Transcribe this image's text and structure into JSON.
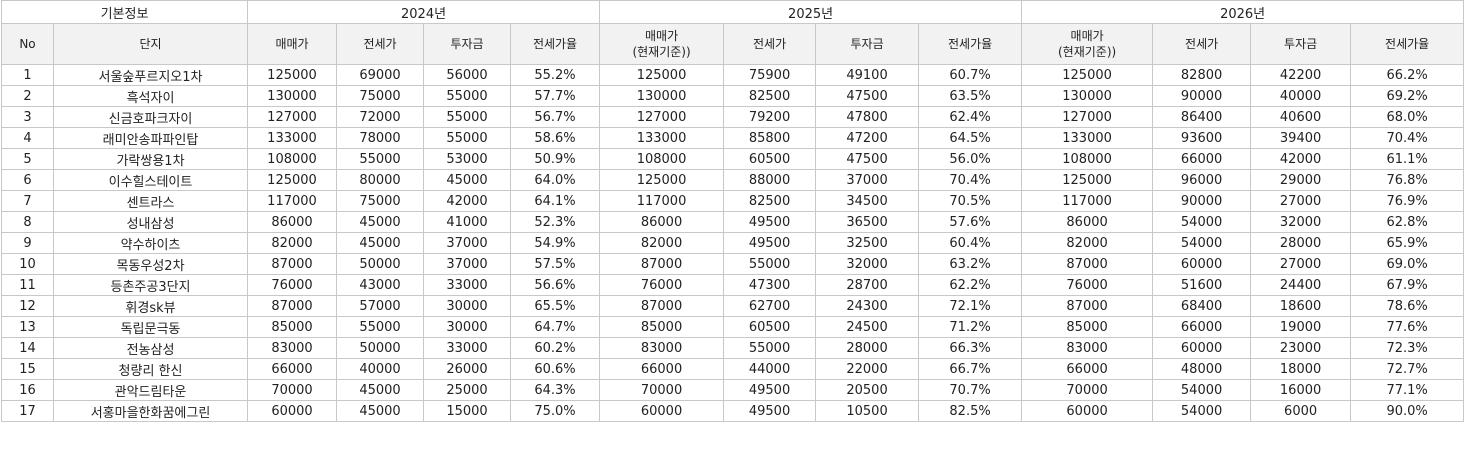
{
  "groups": {
    "basic": "기본정보",
    "y2024": "2024년",
    "y2025": "2025년",
    "y2026": "2026년"
  },
  "headers": {
    "no": "No",
    "complex": "단지",
    "y2024": {
      "price": "매매가",
      "jeonse": "전세가",
      "invest": "투자금",
      "ratio": "전세가율"
    },
    "y2025": {
      "price_line1": "매매가",
      "price_line2": "(현재기준))",
      "jeonse": "전세가",
      "invest": "투자금",
      "ratio": "전세가율"
    },
    "y2026": {
      "price_line1": "매매가",
      "price_line2": "(현재기준))",
      "jeonse": "전세가",
      "invest": "투자금",
      "ratio": "전세가율"
    }
  },
  "rows": [
    [
      "1",
      "서울숲푸르지오1차",
      "125000",
      "69000",
      "56000",
      "55.2%",
      "125000",
      "75900",
      "49100",
      "60.7%",
      "125000",
      "82800",
      "42200",
      "66.2%"
    ],
    [
      "2",
      "흑석자이",
      "130000",
      "75000",
      "55000",
      "57.7%",
      "130000",
      "82500",
      "47500",
      "63.5%",
      "130000",
      "90000",
      "40000",
      "69.2%"
    ],
    [
      "3",
      "신금호파크자이",
      "127000",
      "72000",
      "55000",
      "56.7%",
      "127000",
      "79200",
      "47800",
      "62.4%",
      "127000",
      "86400",
      "40600",
      "68.0%"
    ],
    [
      "4",
      "래미안송파파인탑",
      "133000",
      "78000",
      "55000",
      "58.6%",
      "133000",
      "85800",
      "47200",
      "64.5%",
      "133000",
      "93600",
      "39400",
      "70.4%"
    ],
    [
      "5",
      "가락쌍용1차",
      "108000",
      "55000",
      "53000",
      "50.9%",
      "108000",
      "60500",
      "47500",
      "56.0%",
      "108000",
      "66000",
      "42000",
      "61.1%"
    ],
    [
      "6",
      "이수힐스테이트",
      "125000",
      "80000",
      "45000",
      "64.0%",
      "125000",
      "88000",
      "37000",
      "70.4%",
      "125000",
      "96000",
      "29000",
      "76.8%"
    ],
    [
      "7",
      "센트라스",
      "117000",
      "75000",
      "42000",
      "64.1%",
      "117000",
      "82500",
      "34500",
      "70.5%",
      "117000",
      "90000",
      "27000",
      "76.9%"
    ],
    [
      "8",
      "성내삼성",
      "86000",
      "45000",
      "41000",
      "52.3%",
      "86000",
      "49500",
      "36500",
      "57.6%",
      "86000",
      "54000",
      "32000",
      "62.8%"
    ],
    [
      "9",
      "약수하이츠",
      "82000",
      "45000",
      "37000",
      "54.9%",
      "82000",
      "49500",
      "32500",
      "60.4%",
      "82000",
      "54000",
      "28000",
      "65.9%"
    ],
    [
      "10",
      "목동우성2차",
      "87000",
      "50000",
      "37000",
      "57.5%",
      "87000",
      "55000",
      "32000",
      "63.2%",
      "87000",
      "60000",
      "27000",
      "69.0%"
    ],
    [
      "11",
      "등촌주공3단지",
      "76000",
      "43000",
      "33000",
      "56.6%",
      "76000",
      "47300",
      "28700",
      "62.2%",
      "76000",
      "51600",
      "24400",
      "67.9%"
    ],
    [
      "12",
      "휘경sk뷰",
      "87000",
      "57000",
      "30000",
      "65.5%",
      "87000",
      "62700",
      "24300",
      "72.1%",
      "87000",
      "68400",
      "18600",
      "78.6%"
    ],
    [
      "13",
      "독립문극동",
      "85000",
      "55000",
      "30000",
      "64.7%",
      "85000",
      "60500",
      "24500",
      "71.2%",
      "85000",
      "66000",
      "19000",
      "77.6%"
    ],
    [
      "14",
      "전농삼성",
      "83000",
      "50000",
      "33000",
      "60.2%",
      "83000",
      "55000",
      "28000",
      "66.3%",
      "83000",
      "60000",
      "23000",
      "72.3%"
    ],
    [
      "15",
      "청량리 한신",
      "66000",
      "40000",
      "26000",
      "60.6%",
      "66000",
      "44000",
      "22000",
      "66.7%",
      "66000",
      "48000",
      "18000",
      "72.7%"
    ],
    [
      "16",
      "관악드림타운",
      "70000",
      "45000",
      "25000",
      "64.3%",
      "70000",
      "49500",
      "20500",
      "70.7%",
      "70000",
      "54000",
      "16000",
      "77.1%"
    ],
    [
      "17",
      "서홍마을한화꿈에그린",
      "60000",
      "45000",
      "15000",
      "75.0%",
      "60000",
      "49500",
      "10500",
      "82.5%",
      "60000",
      "54000",
      "6000",
      "90.0%"
    ]
  ]
}
